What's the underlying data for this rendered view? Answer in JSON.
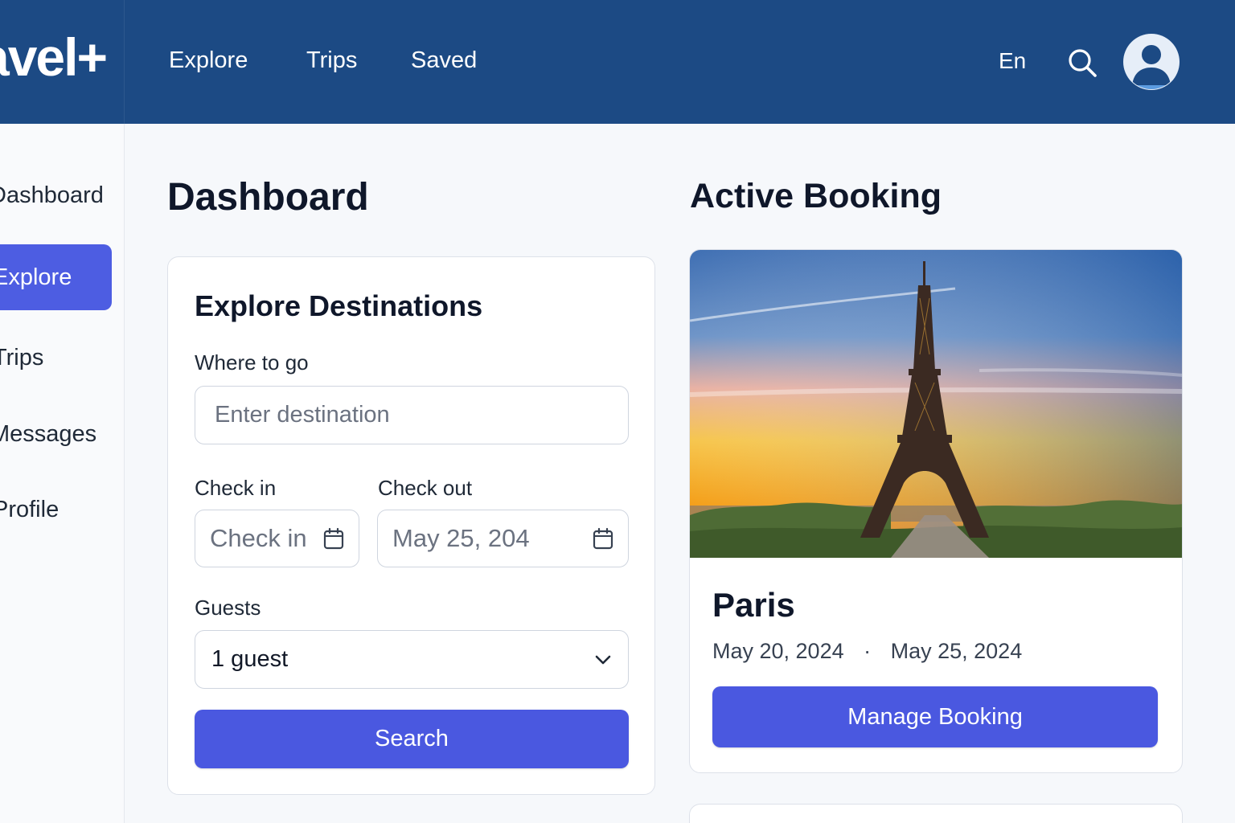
{
  "brand": {
    "name": "avel+"
  },
  "topnav": {
    "items": [
      {
        "label": "Explore"
      },
      {
        "label": "Trips"
      },
      {
        "label": "Saved"
      }
    ],
    "language": "En",
    "search_icon": "search-icon",
    "avatar_icon": "user-avatar-icon"
  },
  "sidebar": {
    "items": [
      {
        "label": "Dashboard",
        "active": false
      },
      {
        "label": "Explore",
        "active": true
      },
      {
        "label": "Trips",
        "active": false
      },
      {
        "label": "Messages",
        "active": false
      },
      {
        "label": "Profile",
        "active": false
      }
    ]
  },
  "page": {
    "title": "Dashboard"
  },
  "explore": {
    "title": "Explore Destinations",
    "where_label": "Where to go",
    "where_placeholder": "Enter destination",
    "checkin_label": "Check in",
    "checkin_placeholder": "Check in",
    "checkout_label": "Check out",
    "checkout_value": "May 25, 204",
    "guests_label": "Guests",
    "guests_value": "1 guest",
    "search_label": "Search"
  },
  "booking": {
    "section_title": "Active Booking",
    "city": "Paris",
    "start_date": "May 20, 2024",
    "separator": "·",
    "end_date": "May 25, 2024",
    "manage_label": "Manage Booking",
    "image": "eiffel-tower-sunset-photo"
  },
  "colors": {
    "topbar": "#1c4a84",
    "accent": "#4a58e0",
    "background": "#f6f8fb"
  }
}
